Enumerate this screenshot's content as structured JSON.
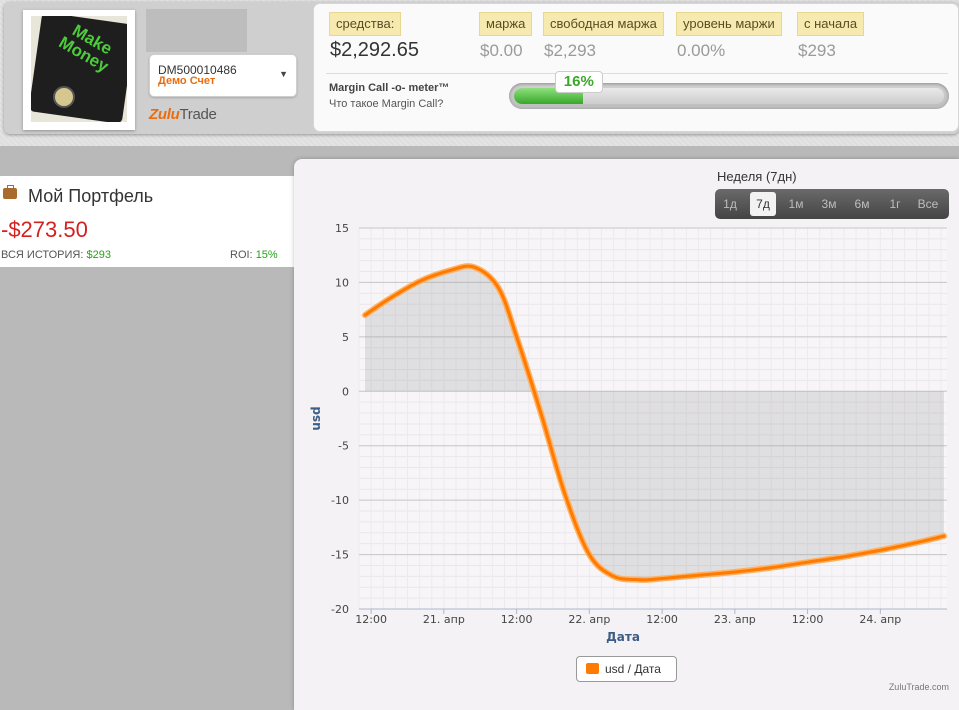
{
  "header": {
    "avatar_text": "Make Money",
    "account": {
      "id": "DM500010486",
      "type": "Демо Счет"
    },
    "logo": {
      "part1": "Zulu",
      "part2": "Trade"
    },
    "stats": [
      {
        "label": "средства:",
        "value": "$2,292.65"
      },
      {
        "label": "маржа",
        "value": "$0.00"
      },
      {
        "label": "свободная маржа",
        "value": "$2,293"
      },
      {
        "label": "уровень маржи",
        "value": "0.00%"
      },
      {
        "label": "с начала",
        "value": "$293"
      }
    ],
    "margin_call": {
      "title": "Margin Call -o- meter™",
      "link": "Что такое Margin Call?",
      "percent_label": "16%",
      "percent": 16,
      "color": "#38a72a"
    }
  },
  "portfolio": {
    "title": "Мой Портфель",
    "value": "-$273.50",
    "history_label": "ВСЯ ИСТОРИЯ:",
    "history_value": "$293",
    "roi_label": "ROI:",
    "roi_value": "15%"
  },
  "period": {
    "label": "Неделя (7дн)",
    "options": [
      "1д",
      "7д",
      "1м",
      "3м",
      "6м",
      "1г",
      "Все"
    ],
    "active_index": 1
  },
  "credit": "ZuluTrade.com",
  "chart_data": {
    "type": "area",
    "xlabel": "Дата",
    "ylabel": "usd",
    "ylim": [
      -20,
      15
    ],
    "yticks": [
      15,
      10,
      5,
      0,
      -5,
      -10,
      -15,
      -20
    ],
    "x_ticks": [
      "12:00",
      "21. апр",
      "12:00",
      "22. апр",
      "12:00",
      "23. апр",
      "12:00",
      "24. апр"
    ],
    "x_tick_hours": [
      12,
      24,
      36,
      48,
      60,
      72,
      84,
      96
    ],
    "xlim": [
      10,
      107
    ],
    "grid": true,
    "legend": "bottom-center",
    "series": [
      {
        "name": "usd / Дата",
        "color": "#ff7a00",
        "x": [
          11,
          15,
          20,
          25,
          29,
          33,
          36,
          40,
          44,
          48,
          52,
          56,
          58,
          60,
          62,
          66,
          72,
          78,
          84,
          90,
          96,
          102,
          106.5
        ],
        "y": [
          7.0,
          8.5,
          10.1,
          11.1,
          11.4,
          9.5,
          5.0,
          -2.0,
          -9.5,
          -15.0,
          -17.0,
          -17.3,
          -17.3,
          -17.2,
          -17.1,
          -16.9,
          -16.6,
          -16.2,
          -15.7,
          -15.2,
          -14.6,
          -13.9,
          -13.3
        ]
      }
    ]
  }
}
